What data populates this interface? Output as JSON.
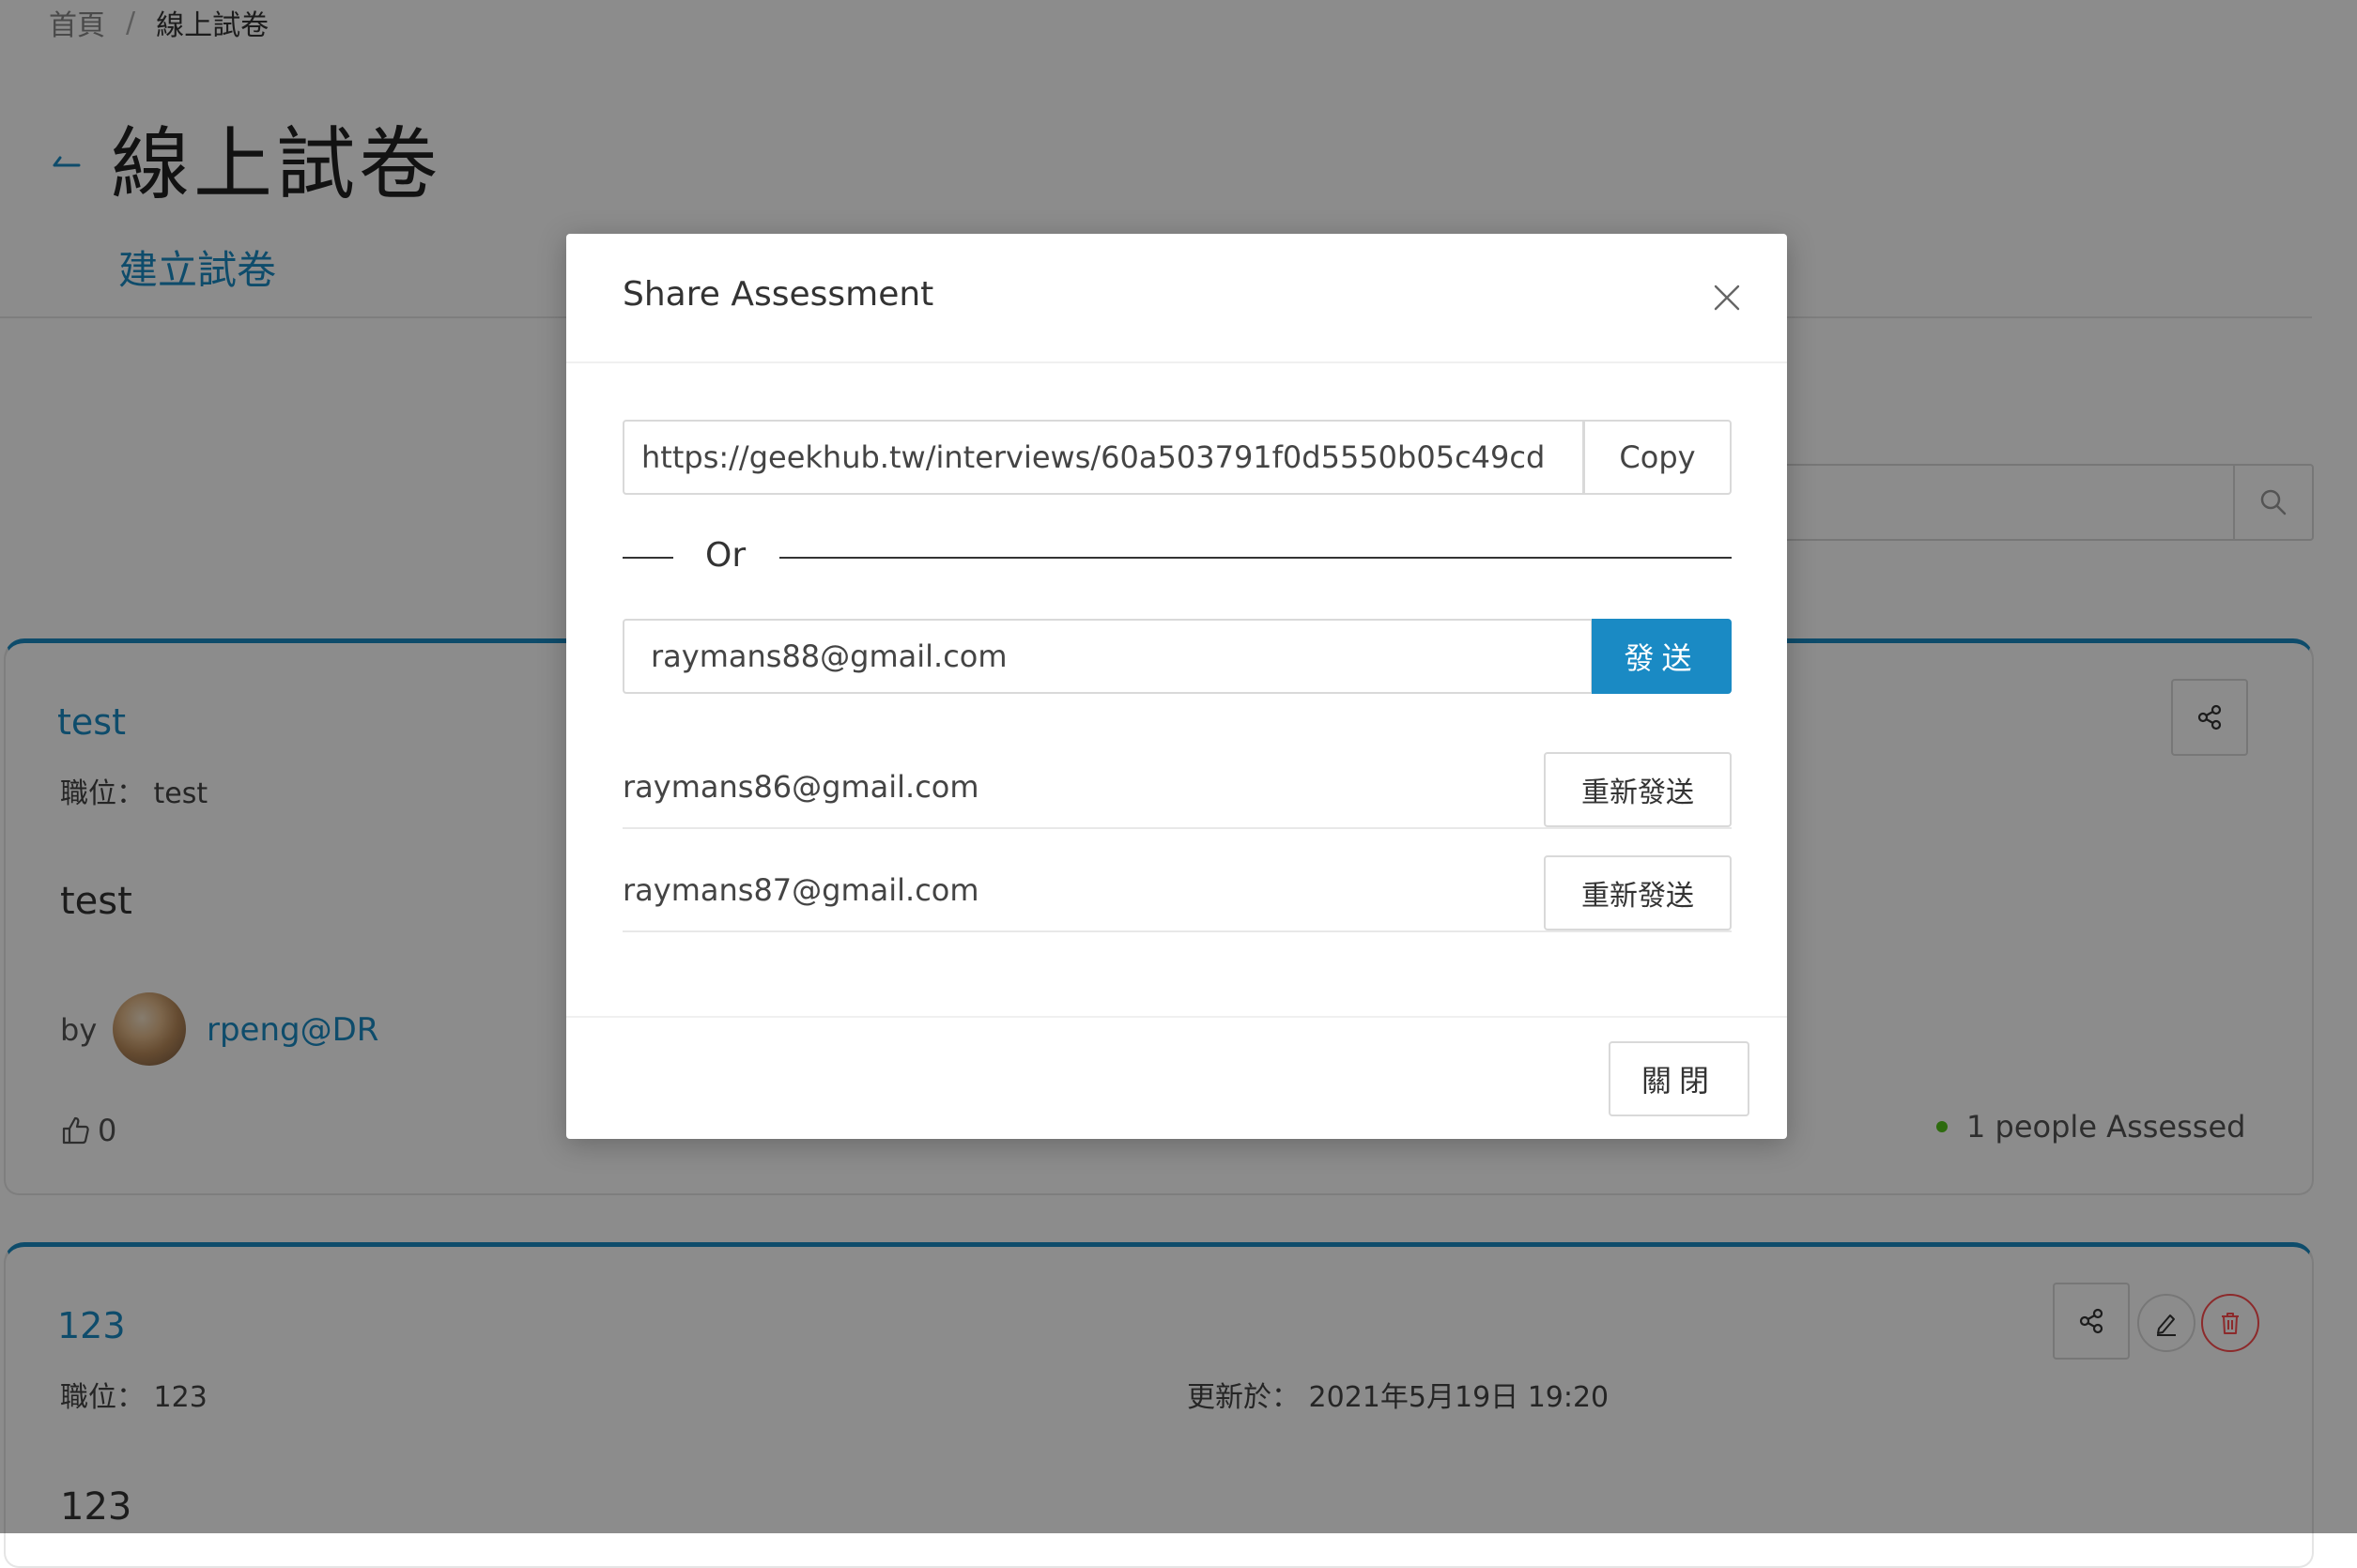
{
  "breadcrumb": {
    "home": "首頁",
    "separator": "/",
    "current": "線上試卷"
  },
  "page": {
    "title": "線上試卷",
    "create_tab": "建立試卷"
  },
  "cards": [
    {
      "title": "test",
      "position_label": "職位：",
      "position": "test",
      "description": "test",
      "by_label": "by",
      "author": "rpeng@DR",
      "likes": "0",
      "assessed": "1 people Assessed"
    },
    {
      "title": "123",
      "position_label": "職位：",
      "position": "123",
      "updated_label": "更新於：",
      "updated": "2021年5月19日 19:20",
      "description": "123"
    }
  ],
  "modal": {
    "title": "Share Assessment",
    "url": "https://geekhub.tw/interviews/60a503791f0d5550b05c49cd",
    "copy_label": "Copy",
    "or_label": "Or",
    "email_value": "raymans88@gmail.com",
    "send_label": "發送",
    "recipients": [
      {
        "email": "raymans86@gmail.com",
        "resend_label": "重新發送"
      },
      {
        "email": "raymans87@gmail.com",
        "resend_label": "重新發送"
      }
    ],
    "close_label": "關閉"
  },
  "colors": {
    "accent": "#1a8ac4",
    "danger": "#ff4d4f",
    "success": "#52c41a"
  },
  "icons": [
    "arrow-left-icon",
    "search-icon",
    "share-icon",
    "edit-icon",
    "delete-icon",
    "like-icon",
    "close-icon"
  ]
}
